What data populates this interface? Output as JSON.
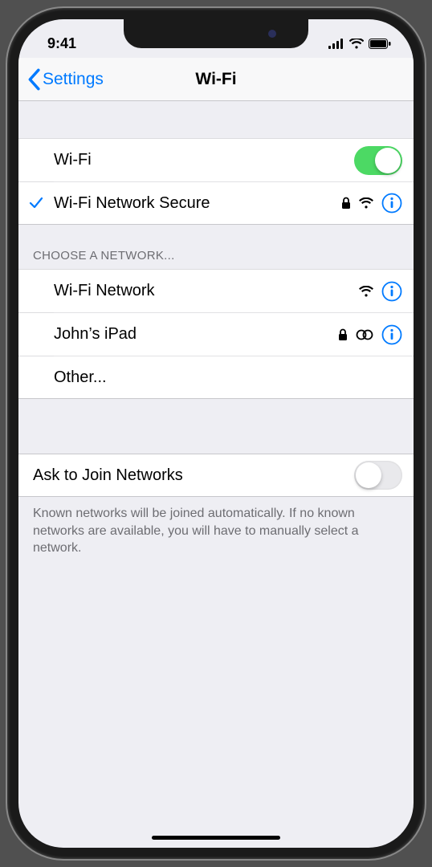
{
  "status": {
    "time": "9:41"
  },
  "nav": {
    "back_label": "Settings",
    "title": "Wi-Fi"
  },
  "wifi": {
    "toggle_label": "Wi-Fi",
    "connected": {
      "name": "Wi-Fi Network Secure"
    }
  },
  "choose_header": "CHOOSE A NETWORK...",
  "networks": [
    {
      "name": "Wi-Fi Network"
    },
    {
      "name": "John’s iPad"
    }
  ],
  "other_label": "Other...",
  "ask": {
    "label": "Ask to Join Networks",
    "footer": "Known networks will be joined automatically. If no known networks are available, you will have to manually select a network."
  }
}
